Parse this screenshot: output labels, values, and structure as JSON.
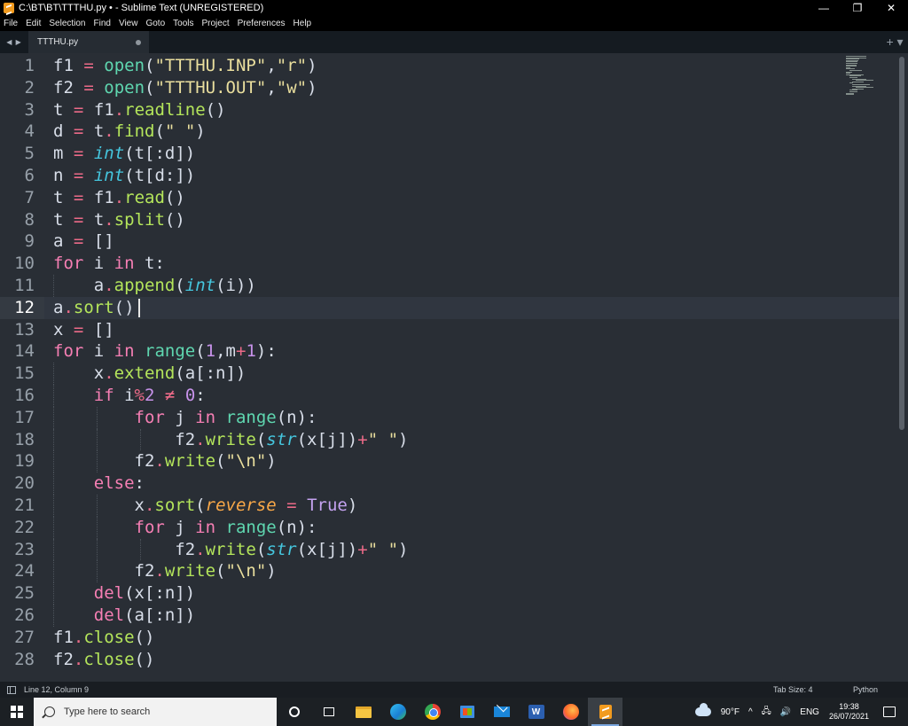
{
  "window": {
    "title": "C:\\BT\\BT\\TTTHU.py • - Sublime Text (UNREGISTERED)",
    "minimize": "—",
    "restore": "❐",
    "close": "✕"
  },
  "menu": [
    "File",
    "Edit",
    "Selection",
    "Find",
    "View",
    "Goto",
    "Tools",
    "Project",
    "Preferences",
    "Help"
  ],
  "tabs": {
    "nav": "◀ ▶",
    "items": [
      {
        "label": "TTTHU.py",
        "dirty": true
      }
    ],
    "add": "+ ▾"
  },
  "editor": {
    "active_line": 12,
    "line_numbers": [
      "1",
      "2",
      "3",
      "4",
      "5",
      "6",
      "7",
      "8",
      "9",
      "10",
      "11",
      "12",
      "13",
      "14",
      "15",
      "16",
      "17",
      "18",
      "19",
      "20",
      "21",
      "22",
      "23",
      "24",
      "25",
      "26",
      "27",
      "28"
    ],
    "lines": [
      [
        [
          "v",
          "f1"
        ],
        [
          "p",
          " "
        ],
        [
          "o",
          "="
        ],
        [
          "p",
          " "
        ],
        [
          "f",
          "open"
        ],
        [
          "p",
          "("
        ],
        [
          "s",
          "\"TTTHU.INP\""
        ],
        [
          "p",
          ","
        ],
        [
          "s",
          "\"r\""
        ],
        [
          "p",
          ")"
        ]
      ],
      [
        [
          "v",
          "f2"
        ],
        [
          "p",
          " "
        ],
        [
          "o",
          "="
        ],
        [
          "p",
          " "
        ],
        [
          "f",
          "open"
        ],
        [
          "p",
          "("
        ],
        [
          "s",
          "\"TTTHU.OUT\""
        ],
        [
          "p",
          ","
        ],
        [
          "s",
          "\"w\""
        ],
        [
          "p",
          ")"
        ]
      ],
      [
        [
          "v",
          "t"
        ],
        [
          "p",
          " "
        ],
        [
          "o",
          "="
        ],
        [
          "p",
          " "
        ],
        [
          "v",
          "f1"
        ],
        [
          "o",
          "."
        ],
        [
          "c",
          "readline"
        ],
        [
          "p",
          "()"
        ]
      ],
      [
        [
          "v",
          "d"
        ],
        [
          "p",
          " "
        ],
        [
          "o",
          "="
        ],
        [
          "p",
          " "
        ],
        [
          "v",
          "t"
        ],
        [
          "o",
          "."
        ],
        [
          "c",
          "find"
        ],
        [
          "p",
          "("
        ],
        [
          "s",
          "\" \""
        ],
        [
          "p",
          ")"
        ]
      ],
      [
        [
          "v",
          "m"
        ],
        [
          "p",
          " "
        ],
        [
          "o",
          "="
        ],
        [
          "p",
          " "
        ],
        [
          "t",
          "int"
        ],
        [
          "p",
          "(t[:d])"
        ]
      ],
      [
        [
          "v",
          "n"
        ],
        [
          "p",
          " "
        ],
        [
          "o",
          "="
        ],
        [
          "p",
          " "
        ],
        [
          "t",
          "int"
        ],
        [
          "p",
          "(t[d:])"
        ]
      ],
      [
        [
          "v",
          "t"
        ],
        [
          "p",
          " "
        ],
        [
          "o",
          "="
        ],
        [
          "p",
          " "
        ],
        [
          "v",
          "f1"
        ],
        [
          "o",
          "."
        ],
        [
          "c",
          "read"
        ],
        [
          "p",
          "()"
        ]
      ],
      [
        [
          "v",
          "t"
        ],
        [
          "p",
          " "
        ],
        [
          "o",
          "="
        ],
        [
          "p",
          " "
        ],
        [
          "v",
          "t"
        ],
        [
          "o",
          "."
        ],
        [
          "c",
          "split"
        ],
        [
          "p",
          "()"
        ]
      ],
      [
        [
          "v",
          "a"
        ],
        [
          "p",
          " "
        ],
        [
          "o",
          "="
        ],
        [
          "p",
          " []"
        ]
      ],
      [
        [
          "k",
          "for"
        ],
        [
          "p",
          " i "
        ],
        [
          "k",
          "in"
        ],
        [
          "p",
          " t:"
        ]
      ],
      [
        [
          "p",
          "    a"
        ],
        [
          "o",
          "."
        ],
        [
          "c",
          "append"
        ],
        [
          "p",
          "("
        ],
        [
          "t",
          "int"
        ],
        [
          "p",
          "(i))"
        ]
      ],
      [
        [
          "v",
          "a"
        ],
        [
          "o",
          "."
        ],
        [
          "c",
          "sort"
        ],
        [
          "p",
          "()"
        ]
      ],
      [
        [
          "v",
          "x"
        ],
        [
          "p",
          " "
        ],
        [
          "o",
          "="
        ],
        [
          "p",
          " []"
        ]
      ],
      [
        [
          "k",
          "for"
        ],
        [
          "p",
          " i "
        ],
        [
          "k",
          "in"
        ],
        [
          "p",
          " "
        ],
        [
          "f",
          "range"
        ],
        [
          "p",
          "("
        ],
        [
          "n",
          "1"
        ],
        [
          "p",
          ",m"
        ],
        [
          "o",
          "+"
        ],
        [
          "n",
          "1"
        ],
        [
          "p",
          "):"
        ]
      ],
      [
        [
          "p",
          "    x"
        ],
        [
          "o",
          "."
        ],
        [
          "c",
          "extend"
        ],
        [
          "p",
          "(a[:n])"
        ]
      ],
      [
        [
          "p",
          "    "
        ],
        [
          "k",
          "if"
        ],
        [
          "p",
          " i"
        ],
        [
          "o",
          "%"
        ],
        [
          "n",
          "2"
        ],
        [
          "p",
          " "
        ],
        [
          "o",
          "≠"
        ],
        [
          "p",
          " "
        ],
        [
          "n",
          "0"
        ],
        [
          "p",
          ":"
        ]
      ],
      [
        [
          "p",
          "        "
        ],
        [
          "k",
          "for"
        ],
        [
          "p",
          " j "
        ],
        [
          "k",
          "in"
        ],
        [
          "p",
          " "
        ],
        [
          "f",
          "range"
        ],
        [
          "p",
          "(n):"
        ]
      ],
      [
        [
          "p",
          "            f2"
        ],
        [
          "o",
          "."
        ],
        [
          "c",
          "write"
        ],
        [
          "p",
          "("
        ],
        [
          "t",
          "str"
        ],
        [
          "p",
          "(x[j])"
        ],
        [
          "o",
          "+"
        ],
        [
          "s",
          "\" \""
        ],
        [
          "p",
          ")"
        ]
      ],
      [
        [
          "p",
          "        f2"
        ],
        [
          "o",
          "."
        ],
        [
          "c",
          "write"
        ],
        [
          "p",
          "("
        ],
        [
          "s",
          "\"\\n\""
        ],
        [
          "p",
          ")"
        ]
      ],
      [
        [
          "p",
          "    "
        ],
        [
          "k",
          "else"
        ],
        [
          "p",
          ":"
        ]
      ],
      [
        [
          "p",
          "        x"
        ],
        [
          "o",
          "."
        ],
        [
          "c",
          "sort"
        ],
        [
          "p",
          "("
        ],
        [
          "a",
          "reverse"
        ],
        [
          "p",
          " "
        ],
        [
          "o",
          "="
        ],
        [
          "p",
          " "
        ],
        [
          "q",
          "True"
        ],
        [
          "p",
          ")"
        ]
      ],
      [
        [
          "p",
          "        "
        ],
        [
          "k",
          "for"
        ],
        [
          "p",
          " j "
        ],
        [
          "k",
          "in"
        ],
        [
          "p",
          " "
        ],
        [
          "f",
          "range"
        ],
        [
          "p",
          "(n):"
        ]
      ],
      [
        [
          "p",
          "            f2"
        ],
        [
          "o",
          "."
        ],
        [
          "c",
          "write"
        ],
        [
          "p",
          "("
        ],
        [
          "t",
          "str"
        ],
        [
          "p",
          "(x[j])"
        ],
        [
          "o",
          "+"
        ],
        [
          "s",
          "\" \""
        ],
        [
          "p",
          ")"
        ]
      ],
      [
        [
          "p",
          "        f2"
        ],
        [
          "o",
          "."
        ],
        [
          "c",
          "write"
        ],
        [
          "p",
          "("
        ],
        [
          "s",
          "\"\\n\""
        ],
        [
          "p",
          ")"
        ]
      ],
      [
        [
          "p",
          "    "
        ],
        [
          "k",
          "del"
        ],
        [
          "p",
          "(x[:n])"
        ]
      ],
      [
        [
          "p",
          "    "
        ],
        [
          "k",
          "del"
        ],
        [
          "p",
          "(a[:n])"
        ]
      ],
      [
        [
          "v",
          "f1"
        ],
        [
          "o",
          "."
        ],
        [
          "c",
          "close"
        ],
        [
          "p",
          "()"
        ]
      ],
      [
        [
          "v",
          "f2"
        ],
        [
          "o",
          "."
        ],
        [
          "c",
          "close"
        ],
        [
          "p",
          "()"
        ]
      ]
    ]
  },
  "status": {
    "position": "Line 12, Column 9",
    "tab_size": "Tab Size: 4",
    "syntax": "Python"
  },
  "taskbar": {
    "search_placeholder": "Type here to search",
    "word_letter": "W",
    "weather": "90°F",
    "tray_chevron": "^",
    "network": "🖧",
    "volume": "🔊",
    "language": "ENG",
    "time": "19:38",
    "date": "26/07/2021"
  },
  "colors": {
    "editor_bg": "#292e35",
    "keyword": "#f67fb4",
    "operator": "#ec6a88",
    "function": "#5fd7b0",
    "method": "#b4e55b",
    "string": "#eadf9e",
    "type": "#45c6de",
    "number": "#c792ea"
  }
}
